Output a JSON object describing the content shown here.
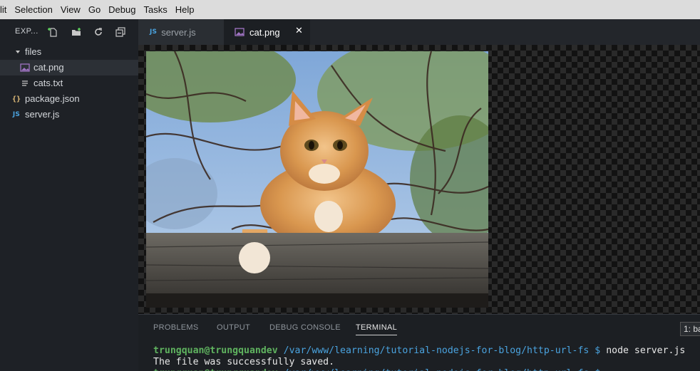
{
  "menu": {
    "items": [
      "lit",
      "Selection",
      "View",
      "Go",
      "Debug",
      "Tasks",
      "Help"
    ]
  },
  "sidebar": {
    "title": "EXP...",
    "actions": [
      "new-file-icon",
      "new-folder-icon",
      "refresh-icon",
      "collapse-all-icon"
    ],
    "tree": [
      {
        "label": "files",
        "type": "folder",
        "expanded": true,
        "icon": "chevron-down-icon"
      },
      {
        "label": "cat.png",
        "type": "file",
        "icon": "image-file-icon",
        "selected": true
      },
      {
        "label": "cats.txt",
        "type": "file",
        "icon": "text-file-icon"
      },
      {
        "label": "package.json",
        "type": "file",
        "icon": "json-file-icon",
        "badge": "{}"
      },
      {
        "label": "server.js",
        "type": "file",
        "icon": "js-file-icon",
        "badge": "JS"
      }
    ]
  },
  "tabs": [
    {
      "label": "server.js",
      "badge": "JS",
      "active": false
    },
    {
      "label": "cat.png",
      "active": true,
      "close": "✕"
    }
  ],
  "editor": {
    "image_name": "cat.png",
    "subject": "orange cat on wooden fence"
  },
  "panel": {
    "tabs": [
      "PROBLEMS",
      "OUTPUT",
      "DEBUG CONSOLE",
      "TERMINAL"
    ],
    "active_tab": "TERMINAL",
    "terminal_select": "1: ba",
    "lines": [
      {
        "user": "trungquan@trungquandev",
        "path": "/var/www/learning/tutorial-nodejs-for-blog/http-url-fs $",
        "cmd": "node server.js"
      },
      {
        "text": "The file was successfully saved."
      }
    ]
  },
  "colors": {
    "menubar": "#dcdcdc",
    "sidebar": "#1e2126",
    "accent_js": "#4aa3df",
    "terminal_user": "#5fb35f",
    "terminal_path": "#4aa3df"
  }
}
